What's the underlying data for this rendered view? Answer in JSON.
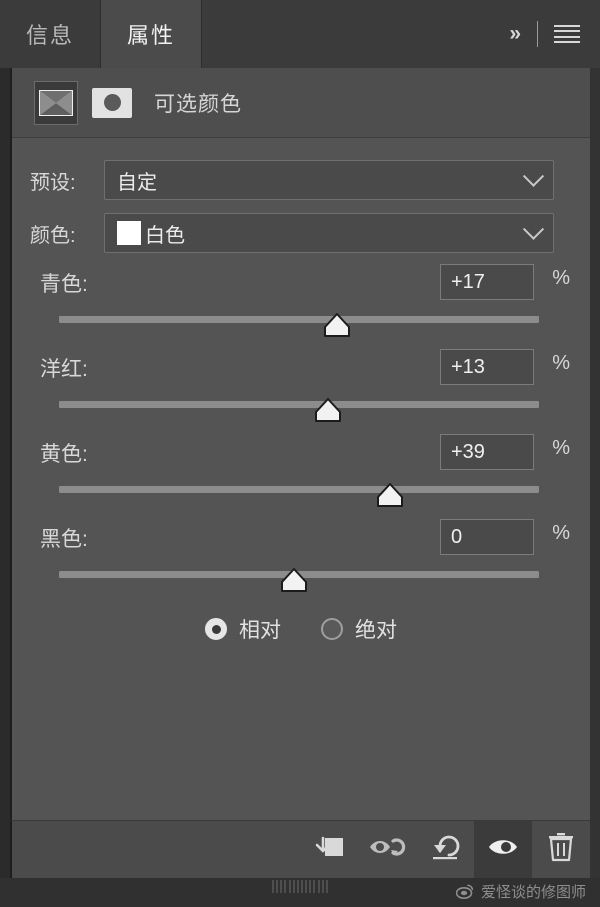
{
  "tabs": [
    {
      "label": "信息",
      "active": false,
      "name": "tab-info"
    },
    {
      "label": "属性",
      "active": true,
      "name": "tab-properties"
    }
  ],
  "header": {
    "collapse_label": "»",
    "collapse_icon": "chevron-double-right-icon",
    "menu_icon": "hamburger-menu-icon"
  },
  "adjustment": {
    "title": "可选颜色",
    "icon": "selective-color-icon",
    "mask_icon": "layer-mask-thumbnail"
  },
  "preset": {
    "label": "预设:",
    "value": "自定"
  },
  "colors": {
    "label": "颜色:",
    "value": "白色",
    "swatch_hex": "#ffffff"
  },
  "sliders": [
    {
      "label": "青色:",
      "value": "+17",
      "unit": "%",
      "pos": 58,
      "name": "cyan"
    },
    {
      "label": "洋红:",
      "value": "+13",
      "unit": "%",
      "pos": 56,
      "name": "magenta"
    },
    {
      "label": "黄色:",
      "value": "+39",
      "unit": "%",
      "pos": 69,
      "name": "yellow"
    },
    {
      "label": "黑色:",
      "value": "0",
      "unit": "%",
      "pos": 49,
      "name": "black"
    }
  ],
  "method": {
    "relative": {
      "label": "相对",
      "selected": true
    },
    "absolute": {
      "label": "绝对",
      "selected": false
    }
  },
  "toolbar": [
    {
      "name": "clip-to-layer-icon",
      "active": false
    },
    {
      "name": "view-previous-state-icon",
      "active": false
    },
    {
      "name": "reset-icon",
      "active": false
    },
    {
      "name": "visibility-eye-icon",
      "active": true
    },
    {
      "name": "delete-icon",
      "active": false
    }
  ],
  "footer": {
    "watermark_text": "爱怪谈的修图师",
    "watermark_icon": "weibo-icon"
  },
  "theme": {
    "panel_bg": "#545454",
    "chrome_bg": "#3b3b3b",
    "text": "#d8d8d8",
    "accent": "#e6e6e6"
  }
}
